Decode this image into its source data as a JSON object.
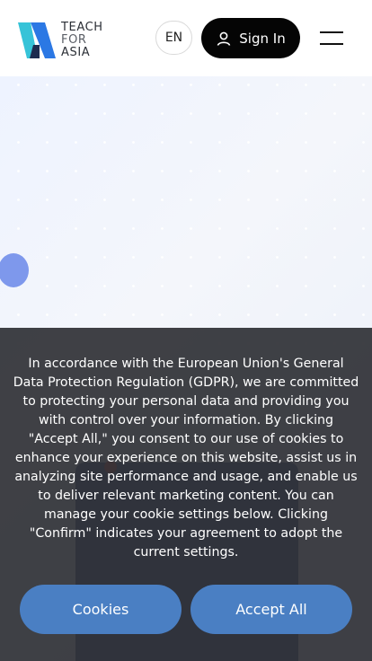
{
  "header": {
    "logo": {
      "line1": "TEACH",
      "line2": "FOR",
      "line3": "ASIA"
    },
    "language": "EN",
    "signin_label": "Sign In"
  },
  "cookie_banner": {
    "text": "In accordance with the European Union's General Data Protection Regulation (GDPR), we are committed to protecting your personal data and providing you with control over your information. By clicking \"Accept All,\" you consent to our use of cookies to enhance your experience on this website, assist us in analyzing site performance and usage, and enable us to deliver relevant marketing content. You can manage your cookie settings below. Clicking \"Confirm\" indicates your agreement to adopt the current settings.",
    "cookies_label": "Cookies",
    "accept_label": "Accept All"
  },
  "colors": {
    "accent": "#4a7fc3",
    "logo_blue": "#2b78e4",
    "logo_cyan": "#36c3d8"
  }
}
